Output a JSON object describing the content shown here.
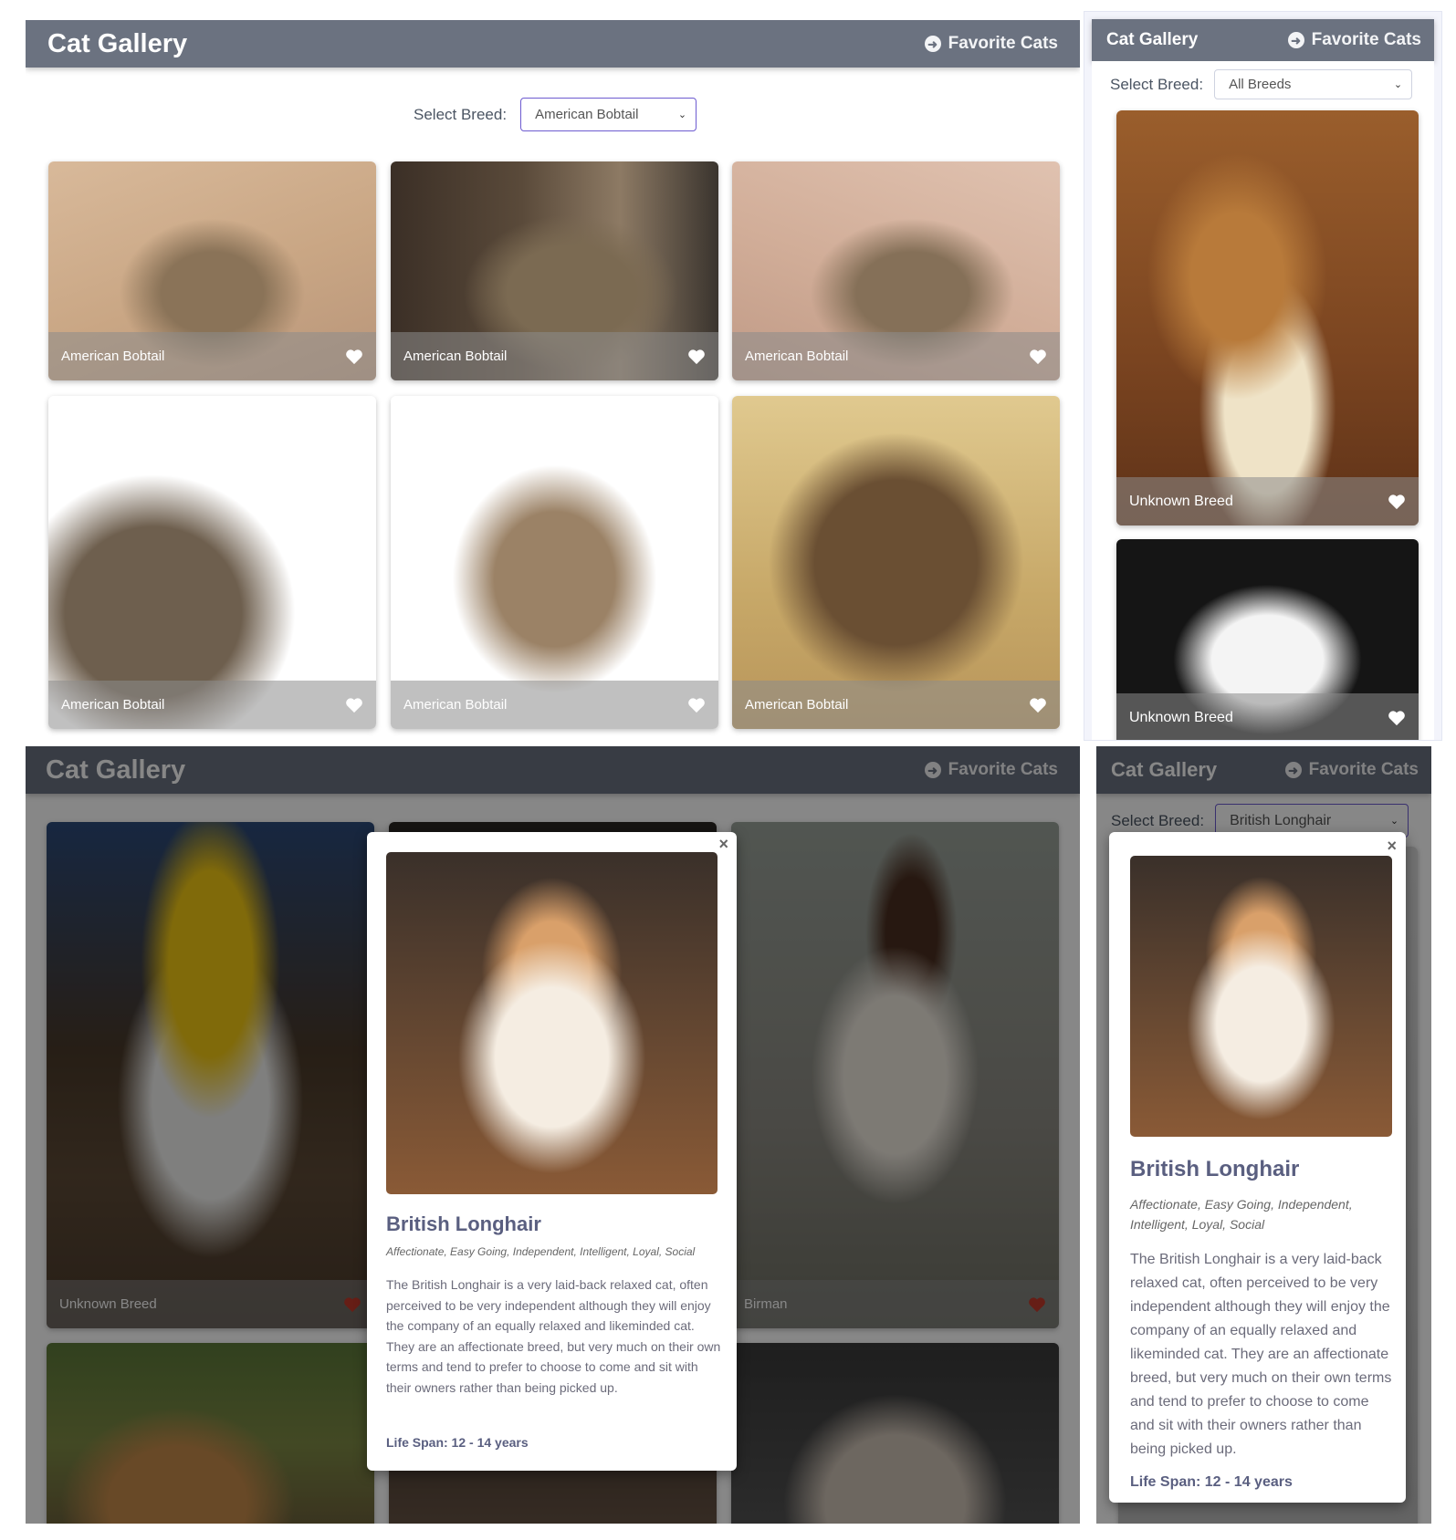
{
  "app": {
    "title": "Cat Gallery",
    "favorites_label": "Favorite Cats",
    "select_label": "Select Breed:"
  },
  "panel_a": {
    "selected_breed": "American Bobtail",
    "cards": [
      {
        "caption": "American Bobtail"
      },
      {
        "caption": "American Bobtail"
      },
      {
        "caption": "American Bobtail"
      },
      {
        "caption": "American Bobtail"
      },
      {
        "caption": "American Bobtail"
      },
      {
        "caption": "American Bobtail"
      }
    ]
  },
  "panel_b": {
    "selected_breed": "All Breeds",
    "cards": [
      {
        "caption": "Unknown Breed"
      },
      {
        "caption": "Unknown Breed"
      }
    ]
  },
  "panel_c": {
    "cards": [
      {
        "caption": "Unknown Breed",
        "favorited": true
      },
      {
        "caption": "Birman",
        "favorited": true
      }
    ]
  },
  "panel_d": {
    "selected_breed": "British Longhair"
  },
  "modal": {
    "close": "×",
    "name": "British Longhair",
    "temperament": "Affectionate, Easy Going, Independent, Intelligent, Loyal, Social",
    "description": "The British Longhair is a very laid-back relaxed cat, often perceived to be very independent although they will enjoy the company of an equally relaxed and likeminded cat. They are an affectionate breed, but very much on their own terms and tend to prefer to choose to come and sit with their owners rather than being picked up.",
    "life_span": "Life Span: 12 - 14 years"
  },
  "colors": {
    "header": "#6b7280",
    "select_border": "#6d5bd0",
    "heart_default": "#ffffff",
    "heart_favorited": "#c0392b",
    "modal_title": "#5a5f80"
  },
  "icons": {
    "favorites": "arrow-circle-right-icon",
    "favorite": "heart-icon",
    "dropdown": "chevron-down-icon",
    "close": "close-icon"
  }
}
